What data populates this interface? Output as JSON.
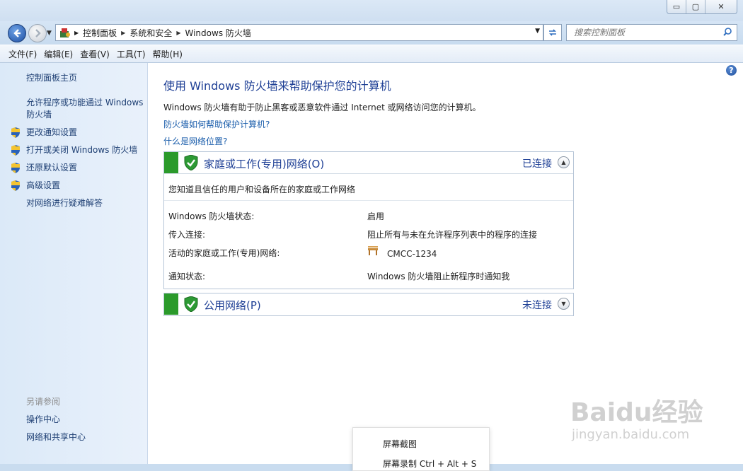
{
  "window": {
    "buttons": {
      "minimize": "▭",
      "maximize": "▢",
      "close": "✕"
    }
  },
  "nav": {
    "breadcrumb": [
      "控制面板",
      "系统和安全",
      "Windows 防火墙"
    ],
    "search_placeholder": "搜索控制面板"
  },
  "menu": [
    "文件(F)",
    "编辑(E)",
    "查看(V)",
    "工具(T)",
    "帮助(H)"
  ],
  "sidebar": {
    "home": "控制面板主页",
    "allow_line1": "允许程序或功能通过 Windows",
    "allow_line2": "防火墙",
    "items": [
      "更改通知设置",
      "打开或关闭 Windows 防火墙",
      "还原默认设置",
      "高级设置"
    ],
    "troubleshoot": "对网络进行疑难解答",
    "see_also": "另请参阅",
    "see_also_items": [
      "操作中心",
      "网络和共享中心"
    ]
  },
  "main": {
    "title": "使用 Windows 防火墙来帮助保护您的计算机",
    "description": "Windows 防火墙有助于防止黑客或恶意软件通过 Internet 或网络访问您的计算机。",
    "link1": "防火墙如何帮助保护计算机?",
    "link2": "什么是网络位置?"
  },
  "home_panel": {
    "title": "家庭或工作(专用)网络(O)",
    "status": "已连接",
    "intro": "您知道且信任的用户和设备所在的家庭或工作网络",
    "rows": [
      {
        "label": "Windows 防火墙状态:",
        "value": "启用"
      },
      {
        "label": "传入连接:",
        "value": "阻止所有与未在允许程序列表中的程序的连接"
      },
      {
        "label": "活动的家庭或工作(专用)网络:",
        "value": "CMCC-1234"
      },
      {
        "label": "通知状态:",
        "value": "Windows 防火墙阻止新程序时通知我"
      }
    ]
  },
  "public_panel": {
    "title": "公用网络(P)",
    "status": "未连接"
  },
  "context_menu": {
    "item1": "屏幕截图",
    "item2": "屏幕录制 Ctrl + Alt + S"
  },
  "watermark": {
    "brand": "Baidu经验",
    "url": "jingyan.baidu.com"
  },
  "colors": {
    "link": "#1a5dab",
    "title": "#1e3f95",
    "green": "#2b9a2b"
  }
}
